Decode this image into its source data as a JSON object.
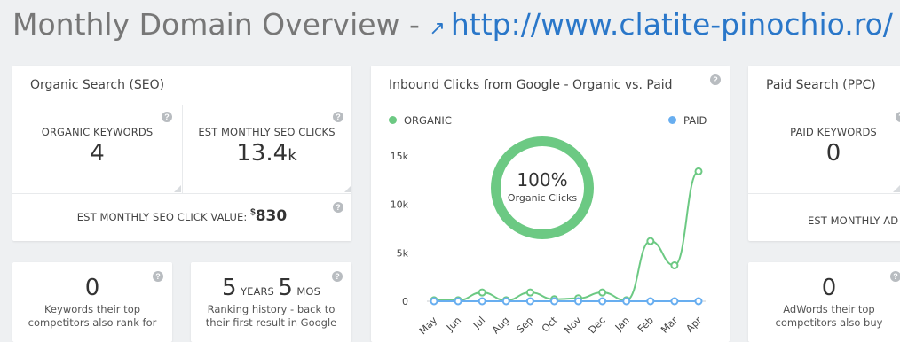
{
  "header": {
    "title": "Monthly Domain Overview - ",
    "url": "http://www.clatite-pinochio.ro/",
    "external_icon": "external-link-icon"
  },
  "seo": {
    "title": "Organic Search (SEO)",
    "organic_keywords_label": "ORGANIC KEYWORDS",
    "organic_keywords_value": "4",
    "est_clicks_label": "EST MONTHLY SEO CLICKS",
    "est_clicks_value": "13.4",
    "est_clicks_unit": "k",
    "click_value_label": "EST MONTHLY SEO CLICK VALUE: ",
    "click_value_currency": "$",
    "click_value": "830"
  },
  "competitors_keywords": {
    "value": "0",
    "text": "Keywords their top competitors also rank for"
  },
  "ranking_history": {
    "years": "5",
    "years_label": "YEARS",
    "months": "5",
    "months_label": "MOS",
    "text": "Ranking history - back to their first result in Google"
  },
  "chart_card": {
    "title": "Inbound Clicks from Google - Organic vs. Paid",
    "donut_percent": "100%",
    "donut_label": "Organic Clicks"
  },
  "chart_data": {
    "type": "line",
    "x": [
      "May",
      "Jun",
      "Jul",
      "Aug",
      "Sep",
      "Oct",
      "Nov",
      "Dec",
      "Jan",
      "Feb",
      "Mar",
      "Apr"
    ],
    "series": [
      {
        "name": "ORGANIC",
        "color": "#6cc983",
        "values": [
          100,
          100,
          900,
          100,
          900,
          200,
          300,
          900,
          100,
          6200,
          3700,
          13400
        ]
      },
      {
        "name": "PAID",
        "color": "#68aef0",
        "values": [
          0,
          0,
          0,
          0,
          0,
          0,
          0,
          0,
          0,
          0,
          0,
          0
        ]
      }
    ],
    "ylim": [
      0,
      17000
    ],
    "yticks": [
      0,
      5000,
      10000,
      15000
    ],
    "ytick_labels": [
      "0",
      "5k",
      "10k",
      "15k"
    ],
    "legend_position": "top"
  },
  "ppc": {
    "title": "Paid Search (PPC)",
    "paid_keywords_label": "PAID KEYWORDS",
    "paid_keywords_value": "0",
    "est_monthly_label": "EST MONTHLY AD"
  },
  "adwords_competitors": {
    "value": "0",
    "text": "AdWords their top competitors also buy"
  },
  "colors": {
    "organic": "#6cc983",
    "paid": "#68aef0",
    "link": "#2a77c9"
  }
}
